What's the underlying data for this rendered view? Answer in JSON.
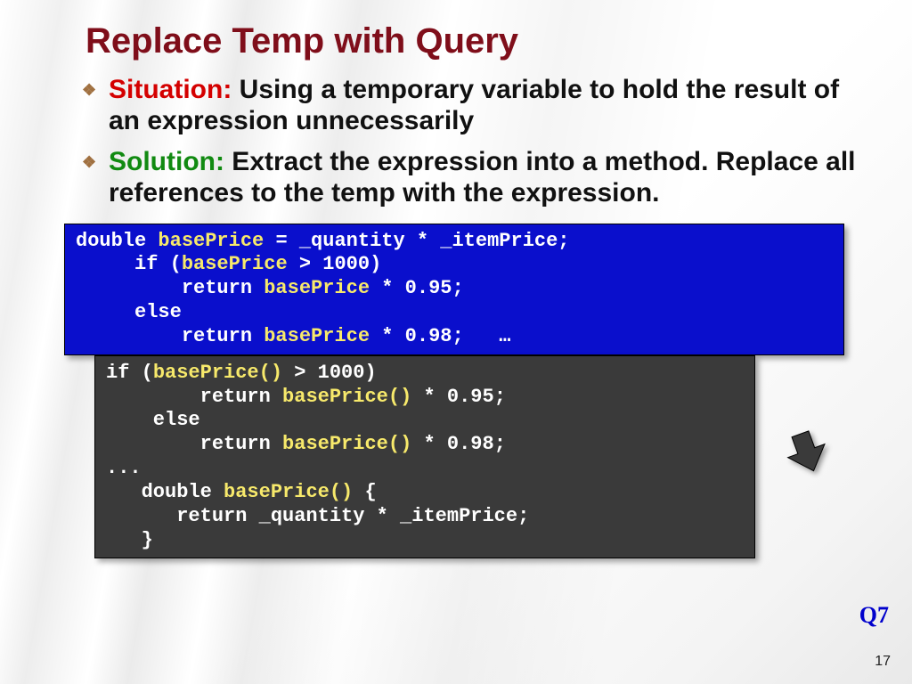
{
  "title": "Replace Temp with Query",
  "bullets": {
    "situation": {
      "label": "Situation:",
      "text": " Using a temporary variable to hold the result of an expression unnecessarily"
    },
    "solution": {
      "label": "Solution:",
      "text": " Extract the expression into a method. Replace all references to the temp with the expression."
    }
  },
  "code_before": {
    "l1a": "double ",
    "l1b": "basePrice",
    "l1c": " = _quantity * _itemPrice;",
    "l2a": "     if (",
    "l2b": "basePrice",
    "l2c": " > 1000)",
    "l3a": "         return ",
    "l3b": "basePrice",
    "l3c": " * 0.95;",
    "l4": "     else",
    "l5a": "         return ",
    "l5b": "basePrice",
    "l5c": " * 0.98;   …"
  },
  "code_after": {
    "l1a": "if (",
    "l1b": "basePrice()",
    "l1c": " > 1000)",
    "l2a": "        return ",
    "l2b": "basePrice()",
    "l2c": " * 0.95;",
    "l3": "    else",
    "l4a": "        return ",
    "l4b": "basePrice()",
    "l4c": " * 0.98;",
    "l5": "...",
    "l6a": "   double ",
    "l6b": "basePrice()",
    "l6c": " {",
    "l7": "      return _quantity * _itemPrice;",
    "l8": "   }"
  },
  "qref": "Q7",
  "page_number": "17"
}
